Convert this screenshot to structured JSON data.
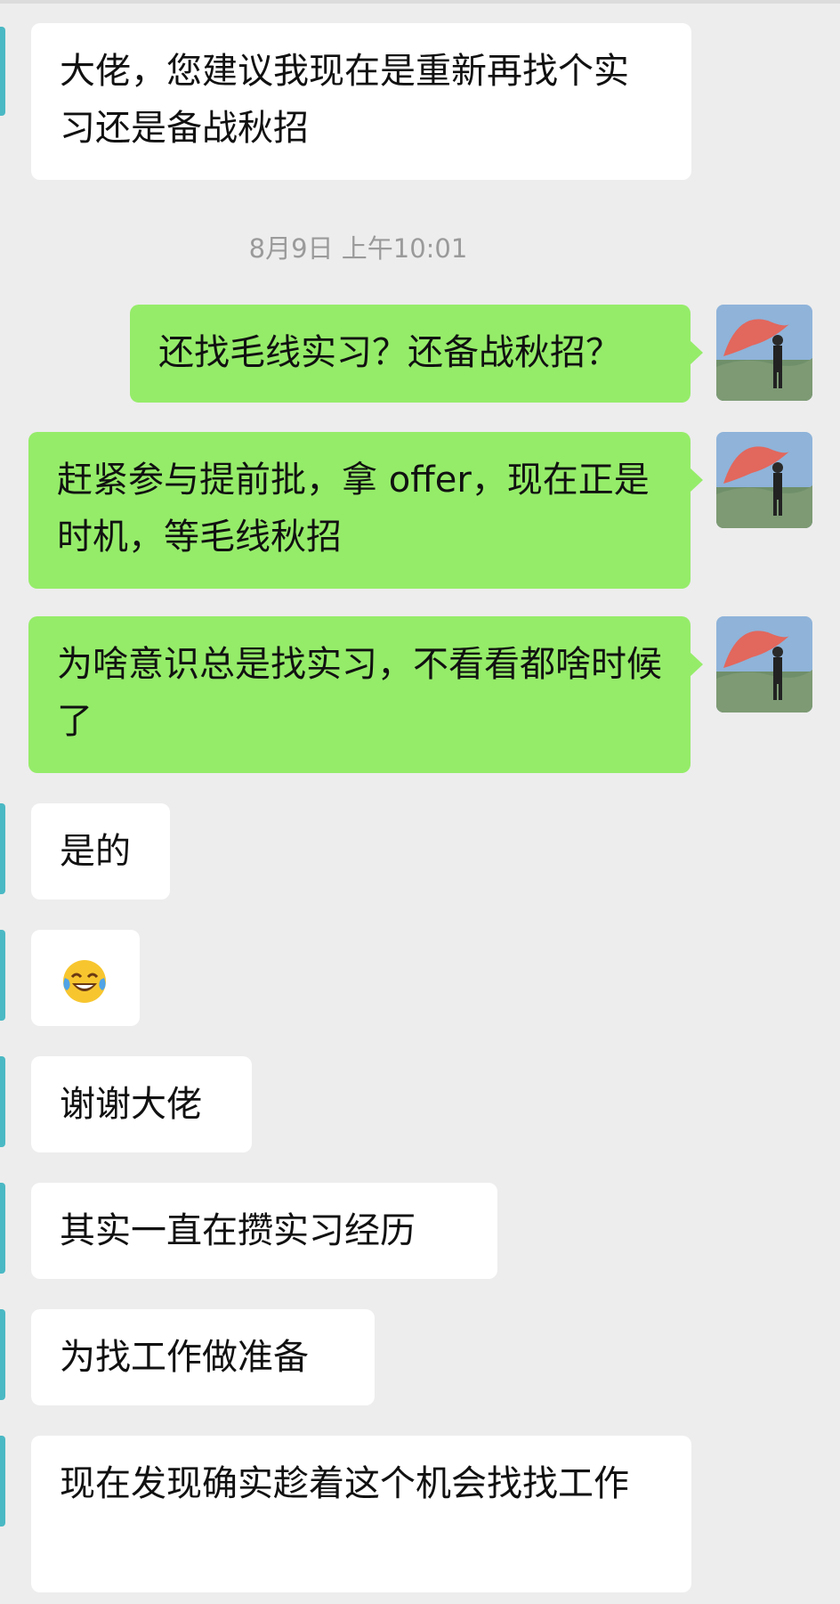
{
  "chat": {
    "timestamp": "8月9日 上午10:01",
    "messages": [
      {
        "side": "in",
        "text": "大佬，您建议我现在是重新再找个实习还是备战秋招"
      },
      {
        "side": "out",
        "text": "还找毛线实习？还备战秋招？"
      },
      {
        "side": "out",
        "text": "赶紧参与提前批，拿 offer，现在正是时机，等毛线秋招"
      },
      {
        "side": "out",
        "text": "为啥意识总是找实习，不看看都啥时候了"
      },
      {
        "side": "in",
        "text": "是的"
      },
      {
        "side": "in",
        "emoji": "tears-of-joy-emoji"
      },
      {
        "side": "in",
        "text": "谢谢大佬"
      },
      {
        "side": "in",
        "text": "其实一直在攒实习经历"
      },
      {
        "side": "in",
        "text": "为找工作做准备"
      },
      {
        "side": "in",
        "text": "现在发现确实趁着这个机会找找工作"
      }
    ]
  },
  "colors": {
    "background": "#ededed",
    "incoming_bubble": "#ffffff",
    "outgoing_bubble": "#95ec69",
    "timestamp_text": "#9a9a9a"
  }
}
